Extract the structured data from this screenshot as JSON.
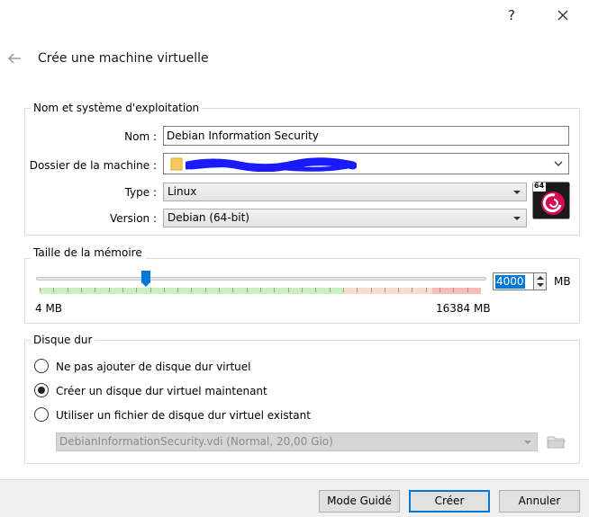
{
  "titlebar": {
    "help_label": "?",
    "close_icon": "close-icon"
  },
  "header": {
    "title": "Crée une machine virtuelle",
    "back_icon": "back-arrow-icon"
  },
  "name_os": {
    "group_title": "Nom et système d'exploitation",
    "name_label": "Nom :",
    "name_value": "Debian Information Security",
    "folder_label": "Dossier de la machine :",
    "folder_value": "",
    "type_label": "Type :",
    "type_value": "Linux",
    "version_label": "Version :",
    "version_value": "Debian (64-bit)",
    "os_badge": "64"
  },
  "memory": {
    "group_title": "Taille de la mémoire",
    "value": "4000",
    "unit": "MB",
    "min_label": "4 MB",
    "max_label": "16384 MB",
    "slider_fraction": 0.244
  },
  "disk": {
    "group_title": "Disque dur",
    "options": [
      {
        "label": "Ne pas ajouter de disque dur virtuel",
        "checked": false
      },
      {
        "label": "Créer un disque dur virtuel maintenant",
        "checked": true
      },
      {
        "label": "Utiliser un fichier de disque dur virtuel existant",
        "checked": false
      }
    ],
    "existing_file": "DebianInformationSecurity.vdi (Normal, 20,00 Gio)"
  },
  "footer": {
    "mode_button": "Mode Guidé",
    "create_button": "Créer",
    "cancel_button": "Annuler"
  },
  "colors": {
    "accent": "#0078d7",
    "redaction": "#1a1aff"
  }
}
